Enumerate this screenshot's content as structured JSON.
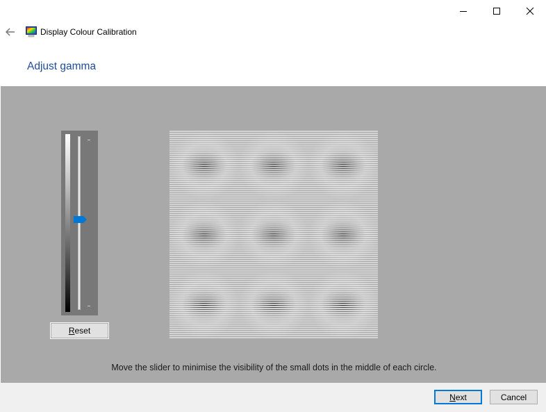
{
  "window": {
    "title": "Display Colour Calibration",
    "controls": {
      "minimize": "minimize-icon",
      "maximize": "maximize-icon",
      "close": "close-icon"
    }
  },
  "nav": {
    "back_icon": "back-arrow-icon",
    "app_icon": "display-monitor-icon"
  },
  "page": {
    "heading": "Adjust gamma"
  },
  "gamma_slider": {
    "value_fraction": 0.52,
    "orientation": "vertical",
    "thumb_color": "#0078d7"
  },
  "reset_button": {
    "label_mnemonic": "R",
    "label_rest": "eset"
  },
  "pattern": {
    "rows": 3,
    "cols": 3,
    "description": "gamma test pattern with small dots in the middle of each circle"
  },
  "instruction": "Move the slider to minimise the visibility of the small dots in the middle of each circle.",
  "footer": {
    "next": {
      "label_mnemonic": "N",
      "label_rest": "ext"
    },
    "cancel": {
      "label": "Cancel"
    }
  },
  "colors": {
    "accent": "#0078d7",
    "heading": "#1e4b9b",
    "panel": "#a9a9a9",
    "footer": "#f0f0f0"
  }
}
